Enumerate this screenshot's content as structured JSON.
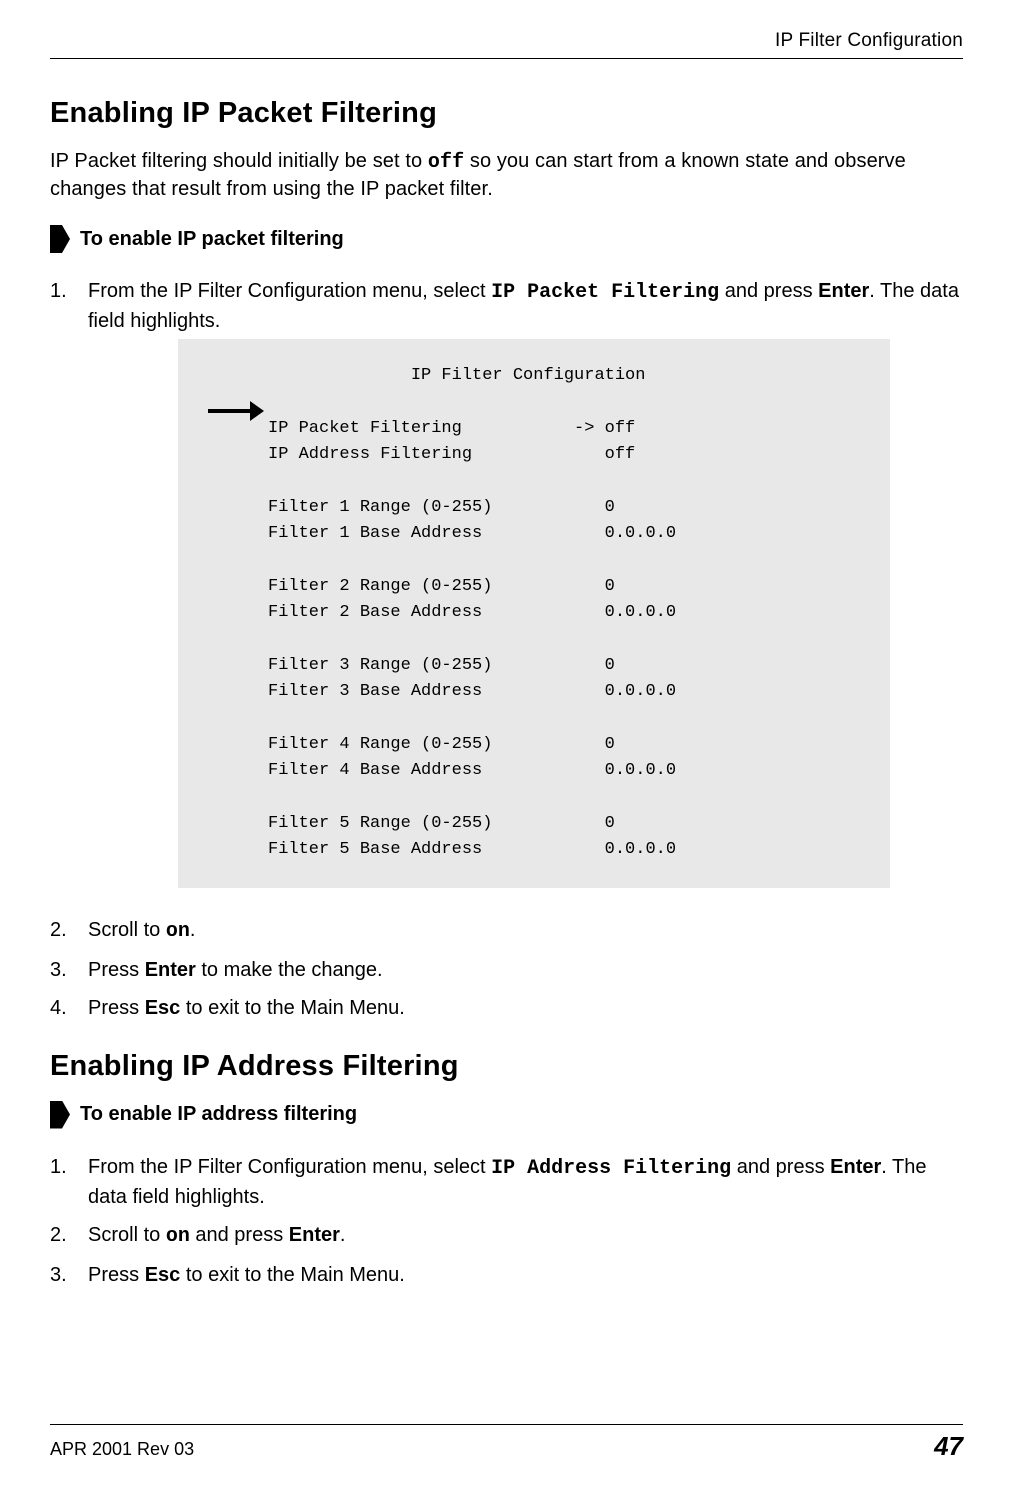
{
  "header": {
    "running_title": "IP Filter Configuration"
  },
  "section1": {
    "heading": "Enabling IP Packet Filtering",
    "intro_pre": "IP Packet filtering should initially be set to ",
    "intro_code": "off",
    "intro_post": " so you can start from a known state and observe changes that result from using the IP packet filter.",
    "proc_title": "To enable IP packet filtering",
    "step1_pre": "From the IP Filter Configuration menu, select ",
    "step1_code": "IP Packet Filtering",
    "step1_mid": " and press ",
    "step1_key": "Enter",
    "step1_post": ". The data field highlights.",
    "step2_pre": "Scroll to ",
    "step2_code": "on",
    "step2_post": ".",
    "step3_pre": "Press ",
    "step3_key": "Enter",
    "step3_post": " to make the change.",
    "step4_pre": "Press ",
    "step4_key": "Esc",
    "step4_post": " to exit to the Main Menu."
  },
  "terminal": {
    "text": "              IP Filter Configuration\n\nIP Packet Filtering           -> off\nIP Address Filtering             off\n\nFilter 1 Range (0-255)           0\nFilter 1 Base Address            0.0.0.0\n\nFilter 2 Range (0-255)           0\nFilter 2 Base Address            0.0.0.0\n\nFilter 3 Range (0-255)           0\nFilter 3 Base Address            0.0.0.0\n\nFilter 4 Range (0-255)           0\nFilter 4 Base Address            0.0.0.0\n\nFilter 5 Range (0-255)           0\nFilter 5 Base Address            0.0.0.0"
  },
  "section2": {
    "heading": "Enabling IP Address Filtering",
    "proc_title": "To enable IP address filtering",
    "step1_pre": "From the IP Filter Configuration menu, select ",
    "step1_code": "IP Address Filtering",
    "step1_mid": " and press ",
    "step1_key": "Enter",
    "step1_post": ". The data field highlights.",
    "step2_pre": "Scroll to ",
    "step2_code": "on",
    "step2_mid": " and press ",
    "step2_key": "Enter",
    "step2_post": ".",
    "step3_pre": "Press ",
    "step3_key": "Esc",
    "step3_post": " to exit to the Main Menu."
  },
  "footer": {
    "left": "APR 2001 Rev 03",
    "right": "47"
  },
  "chart_data": {
    "type": "table",
    "title": "IP Filter Configuration",
    "rows": [
      {
        "label": "IP Packet Filtering",
        "value": "off",
        "selected": true
      },
      {
        "label": "IP Address Filtering",
        "value": "off"
      },
      {
        "label": "Filter 1 Range (0-255)",
        "value": "0"
      },
      {
        "label": "Filter 1 Base Address",
        "value": "0.0.0.0"
      },
      {
        "label": "Filter 2 Range (0-255)",
        "value": "0"
      },
      {
        "label": "Filter 2 Base Address",
        "value": "0.0.0.0"
      },
      {
        "label": "Filter 3 Range (0-255)",
        "value": "0"
      },
      {
        "label": "Filter 3 Base Address",
        "value": "0.0.0.0"
      },
      {
        "label": "Filter 4 Range (0-255)",
        "value": "0"
      },
      {
        "label": "Filter 4 Base Address",
        "value": "0.0.0.0"
      },
      {
        "label": "Filter 5 Range (0-255)",
        "value": "0"
      },
      {
        "label": "Filter 5 Base Address",
        "value": "0.0.0.0"
      }
    ]
  }
}
